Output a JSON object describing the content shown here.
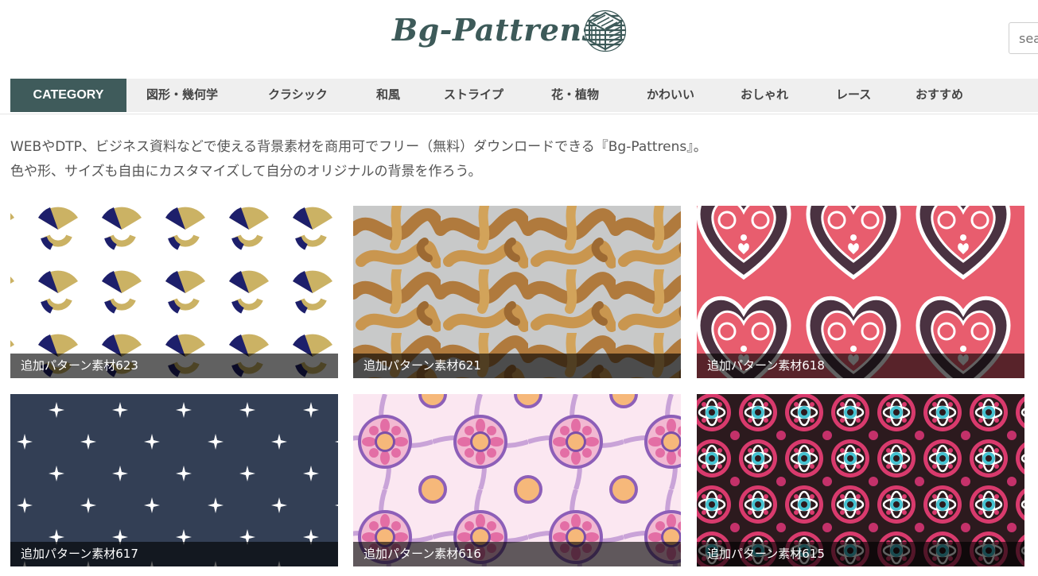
{
  "site": {
    "logo_text": "Bg-Pattrens",
    "logo_icon": "striped-cube-icon"
  },
  "search": {
    "placeholder": "search"
  },
  "nav": {
    "category_label": "CATEGORY",
    "items": [
      "図形・幾何学",
      "クラシック",
      "和風",
      "ストライプ",
      "花・植物",
      "かわいい",
      "おしゃれ",
      "レース",
      "おすすめ"
    ]
  },
  "intro": {
    "line1": "WEBやDTP、ビジネス資料などで使える背景素材を商用可でフリー（無料）ダウンロードできる『Bg-Pattrens』。",
    "line2": "色や形、サイズも自由にカスタマイズして自分のオリジナルの背景を作ろう。"
  },
  "cards": [
    {
      "title": "追加パターン素材623"
    },
    {
      "title": "追加パターン素材621"
    },
    {
      "title": "追加パターン素材618"
    },
    {
      "title": "追加パターン素材617"
    },
    {
      "title": "追加パターン素材616"
    },
    {
      "title": "追加パターン素材615"
    }
  ],
  "colors": {
    "brand": "#3d5a59",
    "nav_bg": "#efefef",
    "category_bg": "#3f5b5b"
  }
}
